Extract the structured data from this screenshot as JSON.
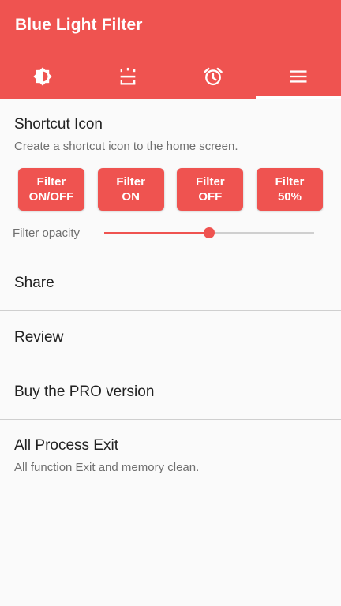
{
  "app": {
    "title": "Blue Light Filter",
    "accent_color": "#ef5350"
  },
  "tabs": [
    {
      "icon": "brightness-icon",
      "active": false
    },
    {
      "icon": "screen-filter-icon",
      "active": false
    },
    {
      "icon": "alarm-clock-icon",
      "active": false
    },
    {
      "icon": "menu-icon",
      "active": true
    }
  ],
  "shortcut": {
    "title": "Shortcut Icon",
    "description": "Create a shortcut icon to the home screen.",
    "buttons": [
      {
        "line1": "Filter",
        "line2": "ON/OFF"
      },
      {
        "line1": "Filter",
        "line2": "ON"
      },
      {
        "line1": "Filter",
        "line2": "OFF"
      },
      {
        "line1": "Filter",
        "line2": "50%"
      }
    ],
    "opacity_label": "Filter opacity",
    "opacity_value": 0.5
  },
  "menu": {
    "share": "Share",
    "review": "Review",
    "buy_pro": "Buy the PRO version"
  },
  "exit": {
    "title": "All Process Exit",
    "description": "All function Exit and memory clean."
  }
}
